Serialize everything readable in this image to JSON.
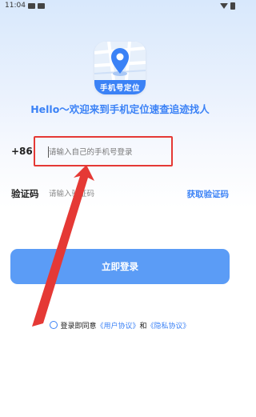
{
  "status_bar": {
    "time": "11:04"
  },
  "app": {
    "logo_text": "手机号定位"
  },
  "welcome": {
    "title": "Hello～欢迎来到手机定位速查追迹找人"
  },
  "phone": {
    "country_code": "+86",
    "placeholder": "请输入自己的手机号登录",
    "value": ""
  },
  "code": {
    "label": "验证码",
    "placeholder": "请输入验证码",
    "value": "",
    "get_code_label": "获取验证码"
  },
  "login": {
    "button_label": "立即登录"
  },
  "agreement": {
    "prefix": "登录即同意",
    "user_agreement": "《用户协议》",
    "and": "和",
    "privacy_policy": "《隐私协议》"
  },
  "colors": {
    "accent": "#3b82f6",
    "button": "#5b9cf6",
    "highlight": "#e53935"
  }
}
